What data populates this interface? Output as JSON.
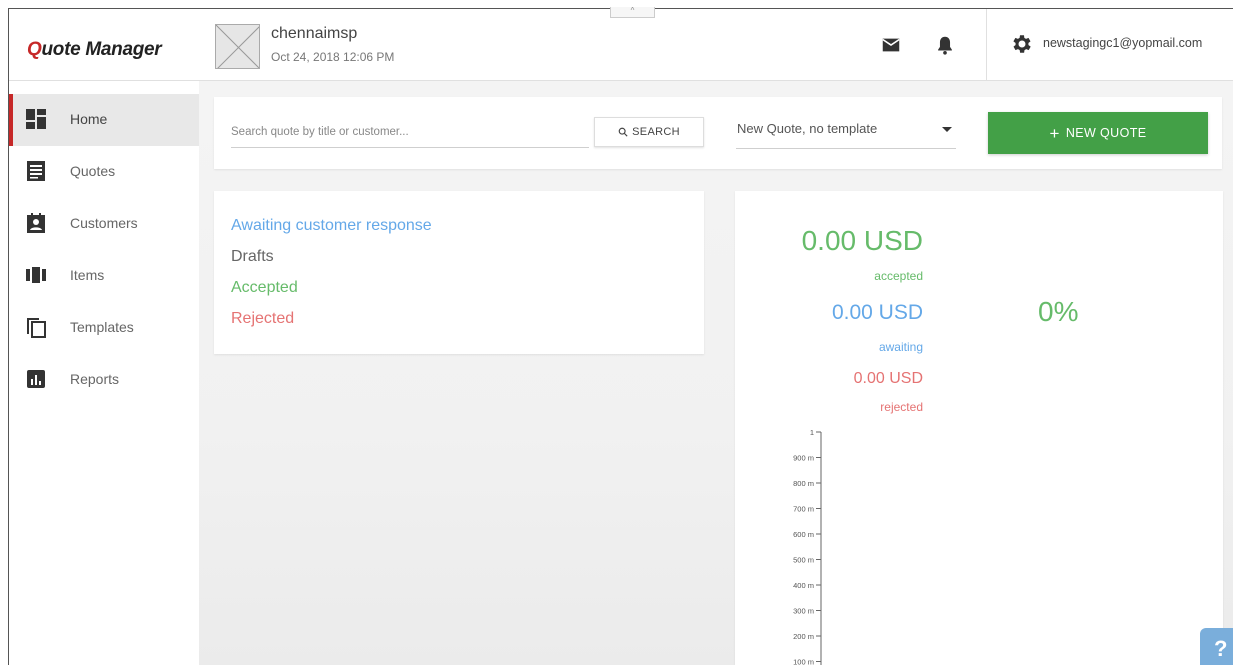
{
  "app": {
    "logo_prefix": "Q",
    "logo_rest": "uote Manager"
  },
  "header": {
    "org_name": "chennaimsp",
    "org_date": "Oct 24, 2018 12:06 PM",
    "collapse_label": "^",
    "user_email": "newstagingc1@yopmail.com",
    "icons": [
      "mail-icon",
      "bell-icon",
      "gear-icon"
    ]
  },
  "sidebar": {
    "items": [
      {
        "label": "Home",
        "icon": "dashboard-icon",
        "active": true
      },
      {
        "label": "Quotes",
        "icon": "quotes-icon",
        "active": false
      },
      {
        "label": "Customers",
        "icon": "customers-icon",
        "active": false
      },
      {
        "label": "Items",
        "icon": "items-icon",
        "active": false
      },
      {
        "label": "Templates",
        "icon": "templates-icon",
        "active": false
      },
      {
        "label": "Reports",
        "icon": "reports-icon",
        "active": false
      }
    ]
  },
  "toolbar": {
    "search_placeholder": "Search quote by title or customer...",
    "search_value": "",
    "search_button": "SEARCH",
    "template_selected": "New Quote, no template",
    "new_quote_button": "NEW QUOTE"
  },
  "status": {
    "awaiting": "Awaiting customer response",
    "drafts": "Drafts",
    "accepted": "Accepted",
    "rejected": "Rejected"
  },
  "totals": {
    "accepted_amount": "0.00 USD",
    "accepted_label": "accepted",
    "awaiting_amount": "0.00 USD",
    "awaiting_label": "awaiting",
    "rejected_amount": "0.00 USD",
    "rejected_label": "rejected",
    "percent": "0%"
  },
  "chart_data": {
    "type": "bar",
    "title": "",
    "xlabel": "",
    "ylabel": "",
    "ylim": [
      0,
      1
    ],
    "tick_labels": [
      "1",
      "900 m",
      "800 m",
      "700 m",
      "600 m",
      "500 m",
      "400 m",
      "300 m",
      "200 m",
      "100 m"
    ],
    "categories": [],
    "values": []
  },
  "colors": {
    "accent_red": "#c62828",
    "green": "#43a047",
    "accepted": "#66bb6a",
    "awaiting": "#64a8e8",
    "rejected": "#e57373"
  },
  "help": {
    "label": "?"
  }
}
